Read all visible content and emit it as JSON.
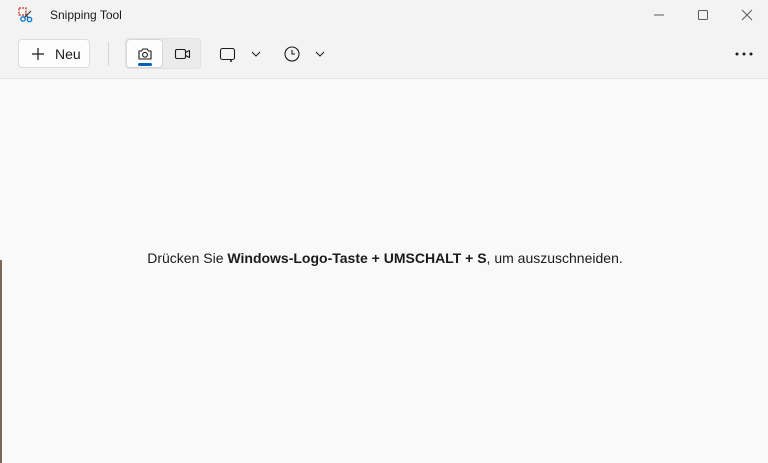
{
  "window": {
    "title": "Snipping Tool",
    "icons": {
      "app": "snipping-tool-icon",
      "minimize": "minimize-icon",
      "maximize": "maximize-icon",
      "close": "close-icon"
    }
  },
  "toolbar": {
    "new_label": "Neu",
    "new_icon": "plus-icon",
    "modes": [
      {
        "name": "screenshot",
        "icon": "camera-icon",
        "selected": true
      },
      {
        "name": "video",
        "icon": "video-camera-icon",
        "selected": false
      }
    ],
    "shape_dropdown_icon": "rectangle-snip-icon",
    "timer_dropdown_icon": "clock-icon",
    "more_icon": "more-dots-icon"
  },
  "content": {
    "hint_prefix": "Drücken Sie ",
    "hint_keys": "Windows-Logo-Taste + UMSCHALT + S",
    "hint_suffix": ", um auszuschneiden."
  },
  "colors": {
    "accent": "#005fb8",
    "background": "#f9f9f9",
    "toolbar": "#f3f3f3",
    "text": "#1b1b1b"
  }
}
